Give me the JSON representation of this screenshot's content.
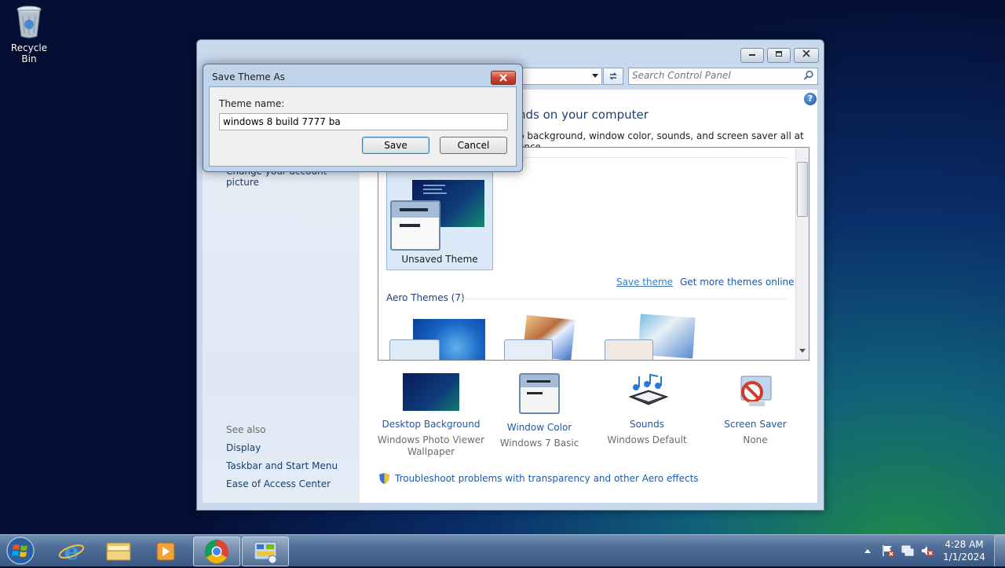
{
  "desktop": {
    "recycle_bin_label": "Recycle Bin"
  },
  "window": {
    "search_placeholder": "Search Control Panel",
    "left_pane": {
      "change_picture_link": "Change your account picture",
      "see_also_heading": "See also",
      "see_also_links": [
        "Display",
        "Taskbar and Start Menu",
        "Ease of Access Center"
      ]
    },
    "heading_partial": "nds on your computer",
    "subheading_partial": "p background, window color, sounds, and screen saver all at once.",
    "my_themes": {
      "unsaved_theme_label": "Unsaved Theme",
      "save_theme_link": "Save theme",
      "get_more_link": "Get more themes online"
    },
    "aero_themes_heading": "Aero Themes (7)",
    "bottom_items": [
      {
        "label": "Desktop Background",
        "sub1": "Windows Photo Viewer",
        "sub2": "Wallpaper"
      },
      {
        "label": "Window Color",
        "sub1": "Windows 7 Basic",
        "sub2": ""
      },
      {
        "label": "Sounds",
        "sub1": "Windows Default",
        "sub2": ""
      },
      {
        "label": "Screen Saver",
        "sub1": "None",
        "sub2": ""
      }
    ],
    "troubleshoot_link": "Troubleshoot problems with transparency and other Aero effects"
  },
  "dialog": {
    "title": "Save Theme As",
    "field_label": "Theme name:",
    "field_value": "windows 8 build 7777 ba",
    "save_label": "Save",
    "cancel_label": "Cancel"
  },
  "taskbar": {
    "time": "4:28 AM",
    "date": "1/1/2024"
  },
  "colors": {
    "link": "#1e5aa8",
    "close_red": "#c8432f",
    "taskbar": "#4d6d97"
  }
}
